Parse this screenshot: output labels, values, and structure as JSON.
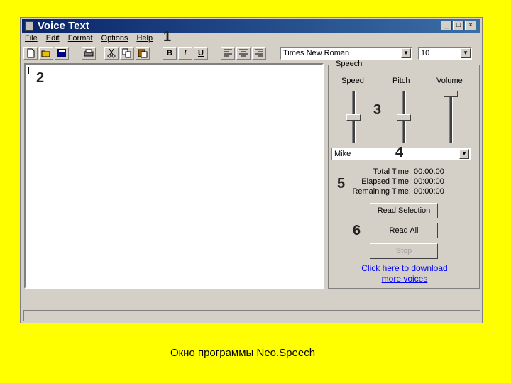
{
  "window": {
    "title": "Voice Text",
    "minimize": "_",
    "maximize": "□",
    "close": "×"
  },
  "menu": [
    "File",
    "Edit",
    "Format",
    "Options",
    "Help"
  ],
  "annotations": {
    "a1": "1",
    "a2": "2",
    "a3": "3",
    "a4": "4",
    "a5": "5",
    "a6": "6"
  },
  "toolbar": {
    "new_icon": "new-document-icon",
    "open_icon": "open-folder-icon",
    "save_icon": "save-disk-icon",
    "print_icon": "printer-icon",
    "cut_icon": "scissors-icon",
    "copy_icon": "copy-icon",
    "paste_icon": "paste-icon",
    "bold": "B",
    "italic": "I",
    "underline": "U",
    "font": "Times New Roman",
    "size": "10"
  },
  "speech": {
    "group_label": "Speech",
    "speed_label": "Speed",
    "pitch_label": "Pitch",
    "volume_label": "Volume",
    "speed_level": 0.5,
    "pitch_level": 0.5,
    "volume_level": 1.0,
    "voice": "Mike",
    "total_label": "Total Time:",
    "total_value": "00:00:00",
    "elapsed_label": "Elapsed Time:",
    "elapsed_value": "00:00:00",
    "remaining_label": "Remaining Time:",
    "remaining_value": "00:00:00",
    "read_selection": "Read Selection",
    "read_all": "Read All",
    "stop": "Stop",
    "download_line1": "Click here to download",
    "download_line2": "more voices"
  },
  "caption": "Окно программы Neo.Speech"
}
